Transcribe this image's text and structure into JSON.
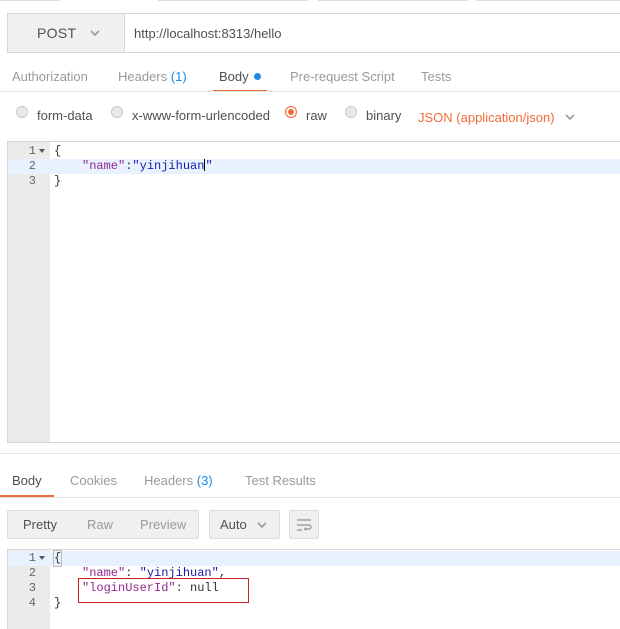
{
  "request": {
    "method": "POST",
    "url": "http://localhost:8313/hello"
  },
  "request_tabs": [
    {
      "label": "Authorization"
    },
    {
      "label": "Headers",
      "count": "(1)"
    },
    {
      "label": "Body"
    },
    {
      "label": "Pre-request Script"
    },
    {
      "label": "Tests"
    }
  ],
  "body_options": {
    "form_data": "form-data",
    "urlencoded": "x-www-form-urlencoded",
    "raw": "raw",
    "binary": "binary",
    "selected": "raw",
    "content_type": "JSON (application/json)"
  },
  "request_editor": {
    "lines": [
      {
        "num": "1",
        "text": "{"
      },
      {
        "num": "2",
        "key": "\"name\"",
        "sep": ":",
        "value": "\"yinjihuan",
        "close": "\""
      },
      {
        "num": "3",
        "text": "}"
      }
    ]
  },
  "response_tabs": [
    {
      "label": "Body"
    },
    {
      "label": "Cookies"
    },
    {
      "label": "Headers",
      "count": "(3)"
    },
    {
      "label": "Test Results"
    }
  ],
  "response_toolbar": {
    "pretty": "Pretty",
    "raw": "Raw",
    "preview": "Preview",
    "format": "Auto"
  },
  "response_editor": {
    "lines": [
      {
        "num": "1",
        "text": "{"
      },
      {
        "num": "2",
        "key": "\"name\"",
        "sep": ": ",
        "value": "\"yinjihuan\"",
        "trail": ","
      },
      {
        "num": "3",
        "key": "\"loginUserId\"",
        "sep": ": ",
        "value": "null"
      },
      {
        "num": "4",
        "text": "}"
      }
    ]
  },
  "colors": {
    "accent": "#f26b3a",
    "count": "#1e88e5",
    "json_key": "#92278f",
    "json_string": "#1a1aa6",
    "highlight_box": "#cc2222"
  },
  "icons": {
    "method_dropdown": "chevron-down-icon",
    "content_type_dropdown": "chevron-down-icon",
    "format_dropdown": "chevron-down-icon",
    "wrap": "wrap-lines-icon",
    "fold": "fold-arrow-icon"
  }
}
